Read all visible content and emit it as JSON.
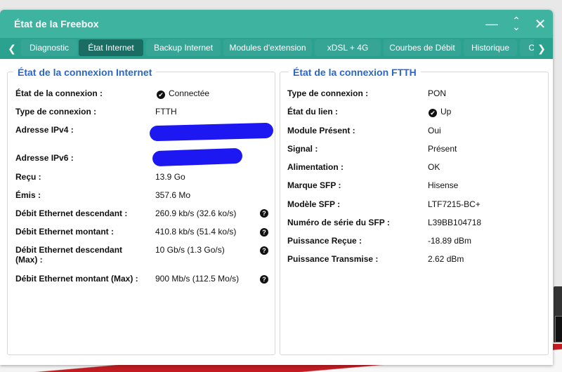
{
  "window": {
    "title": "État de la Freebox"
  },
  "tabs": [
    {
      "label": "Diagnostic"
    },
    {
      "label": "État Internet"
    },
    {
      "label": "Backup Internet"
    },
    {
      "label": "Modules d'extension"
    },
    {
      "label": "xDSL + 4G"
    },
    {
      "label": "Courbes de Débit"
    },
    {
      "label": "Historique"
    },
    {
      "label": "Co"
    }
  ],
  "internet": {
    "title": "État de la connexion Internet",
    "rows": [
      {
        "label": "État de la connexion :",
        "value": "Connectée"
      },
      {
        "label": "Type de connexion :",
        "value": "FTTH"
      },
      {
        "label": "Adresse IPv4 :",
        "value": ""
      },
      {
        "label": "Adresse IPv6 :",
        "value": ""
      },
      {
        "label": "Reçu :",
        "value": "13.9 Go"
      },
      {
        "label": "Émis :",
        "value": "357.6 Mo"
      },
      {
        "label": "Débit Ethernet descendant :",
        "value": "260.9 kb/s (32.6 ko/s)"
      },
      {
        "label": "Débit Ethernet montant :",
        "value": "410.8 kb/s (51.4 ko/s)"
      },
      {
        "label": "Débit Ethernet descendant (Max) :",
        "value": "10 Gb/s (1.3 Go/s)"
      },
      {
        "label": "Débit Ethernet montant (Max) :",
        "value": "900 Mb/s (112.5 Mo/s)"
      }
    ]
  },
  "ftth": {
    "title": "État de la connexion FTTH",
    "rows": [
      {
        "label": "Type de connexion :",
        "value": "PON"
      },
      {
        "label": "État du lien :",
        "value": "Up"
      },
      {
        "label": "Module Présent :",
        "value": "Oui"
      },
      {
        "label": "Signal :",
        "value": "Présent"
      },
      {
        "label": "Alimentation :",
        "value": "OK"
      },
      {
        "label": "Marque SFP :",
        "value": "Hisense"
      },
      {
        "label": "Modèle SFP :",
        "value": "LTF7215-BC+"
      },
      {
        "label": "Numéro de série du SFP :",
        "value": "L39BB104718"
      },
      {
        "label": "Puissance Reçue :",
        "value": "-18.89 dBm"
      },
      {
        "label": "Puissance Transmise :",
        "value": "2.62 dBm"
      }
    ]
  },
  "icons": {
    "help": "?",
    "check": "✔"
  },
  "colors": {
    "titlebar": "#3db3a0",
    "tabbar": "#2ba190",
    "active_tab": "#1b6d63",
    "section_title": "#2a67c8"
  }
}
